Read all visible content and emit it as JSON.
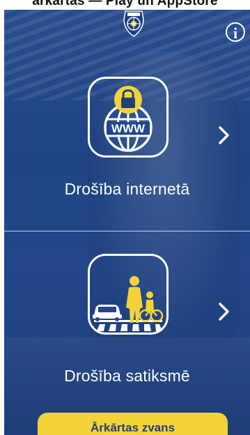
{
  "top_caption": "ārkārtas — Play un AppStore",
  "menu": {
    "internet": {
      "label": "Drošība internetā",
      "icon": "globe-lock-icon"
    },
    "traffic": {
      "label": "Drošība satiksmē",
      "icon": "crosswalk-pedestrians-icon"
    }
  },
  "emergency_button": {
    "label": "Ārkārtas zvans"
  },
  "icons": {
    "info": "info-icon",
    "badge": "police-badge-icon",
    "chevron": "chevron-right-icon"
  },
  "colors": {
    "background": "#23478a",
    "accent": "#f4d33a",
    "text": "#ffffff",
    "button_text": "#1f3f7e"
  }
}
